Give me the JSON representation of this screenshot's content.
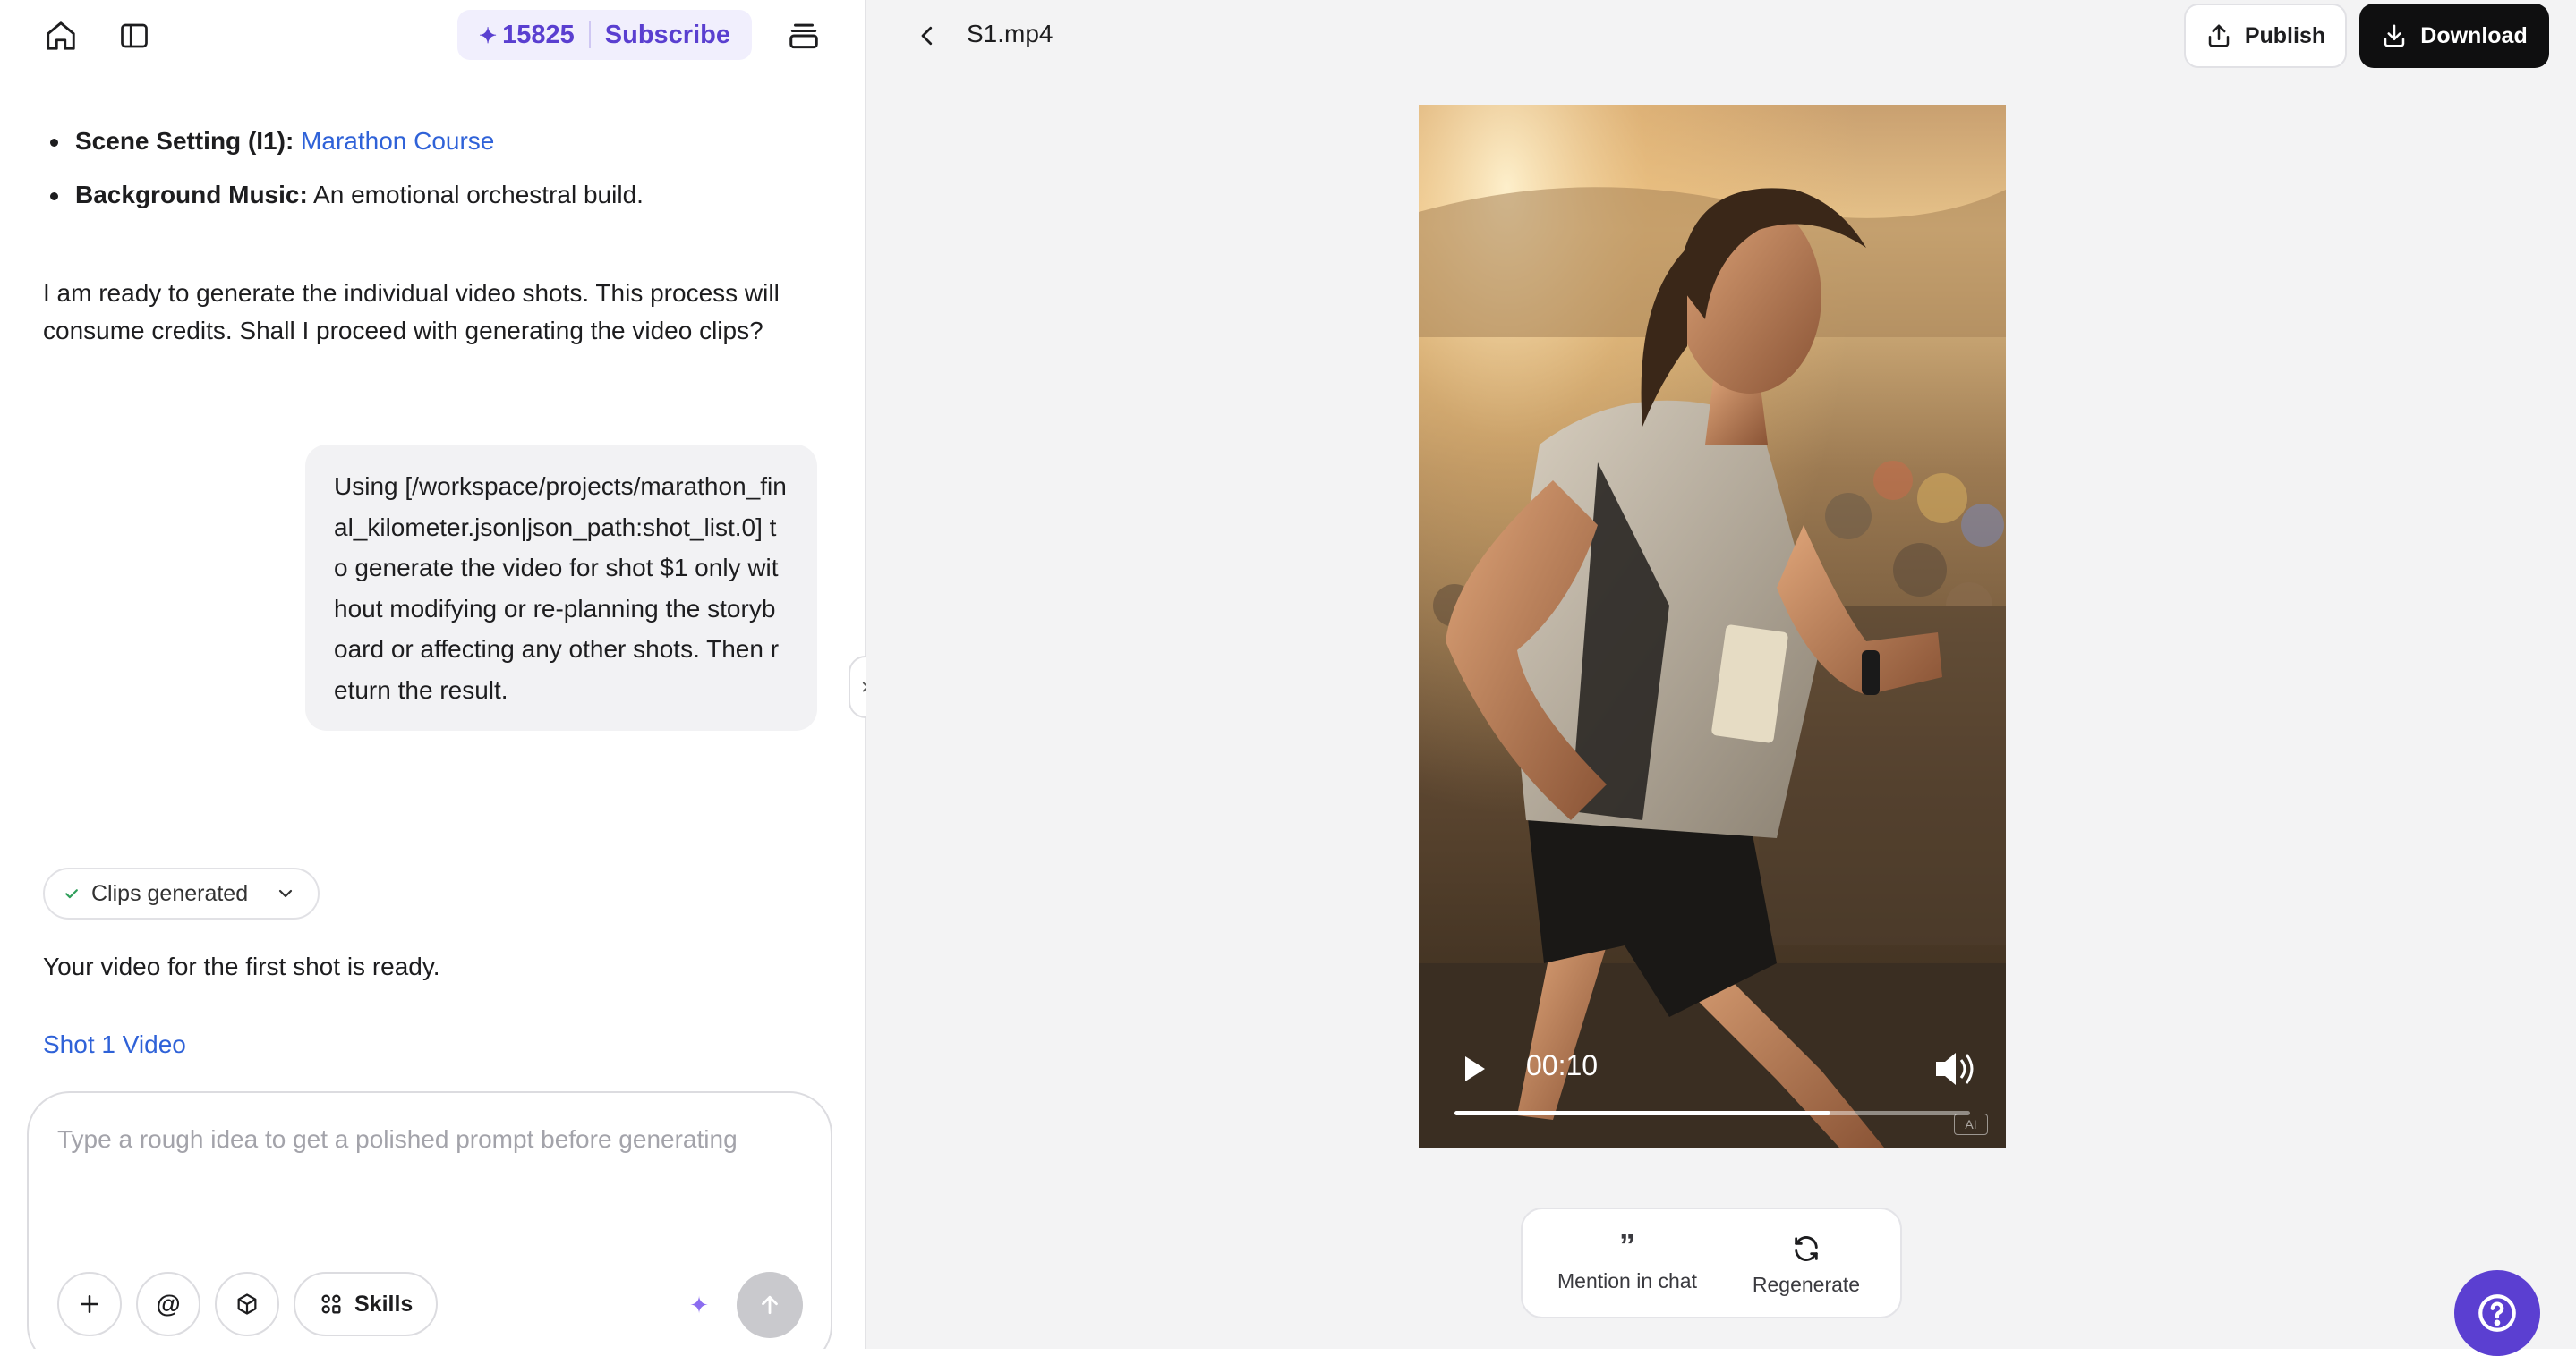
{
  "header": {
    "credits": "15825",
    "subscribe_label": "Subscribe"
  },
  "chat": {
    "bullets": [
      {
        "label": "Scene Setting (I1):",
        "value": "Marathon Course"
      },
      {
        "label": "Background Music:",
        "value": "An emotional orchestral build."
      }
    ],
    "assistant_message": "I am ready to generate the individual video shots. This process will consume credits. Shall I proceed with generating the video clips?",
    "user_message": "Using [/workspace/projects/marathon_final_kilometer.json|json_path:shot_list.0] to generate the video for shot $1 only without modifying or re-planning the storyboard or affecting any other shots. Then return the result.",
    "status_label": "Clips generated",
    "result_message": "Your video for the first shot is ready.",
    "result_link": "Shot 1 Video"
  },
  "composer": {
    "placeholder": "Type a rough idea to get a polished prompt before generating",
    "skills_label": "Skills"
  },
  "preview": {
    "file_name": "S1.mp4",
    "publish_label": "Publish",
    "download_label": "Download",
    "time": "00:10",
    "progress": 0.73,
    "badge": "AI",
    "mention_label": "Mention in chat",
    "regenerate_label": "Regenerate"
  },
  "colors": {
    "accent": "#5b3fd1",
    "link": "#2f62d8"
  }
}
